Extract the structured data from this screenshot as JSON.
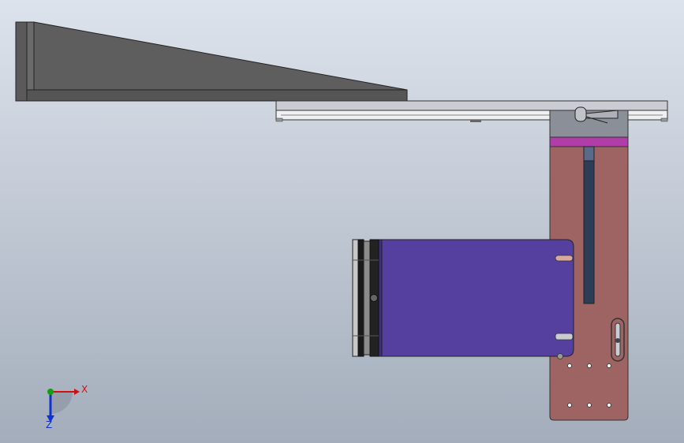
{
  "view": {
    "background_top": "#dde3ec",
    "background_bottom": "#a3adbb"
  },
  "colors": {
    "gray_part": "#5e5e5e",
    "gray_part_dark": "#4a4a4a",
    "rail": "#c9cdd3",
    "rail_light": "#eef0f2",
    "clamp": "#8b8f98",
    "magenta": "#b03da8",
    "plate": "#9e6464",
    "slot": "#2f3c55",
    "camera_body": "#5540a0",
    "lens_ring": "#1a1a1a",
    "lens_silver": "#c8c8c8",
    "x_axis": "#d01010",
    "y_axis": "#10a010",
    "z_axis": "#1030d0"
  },
  "triad": {
    "x_label": "X",
    "z_label": "Z"
  }
}
